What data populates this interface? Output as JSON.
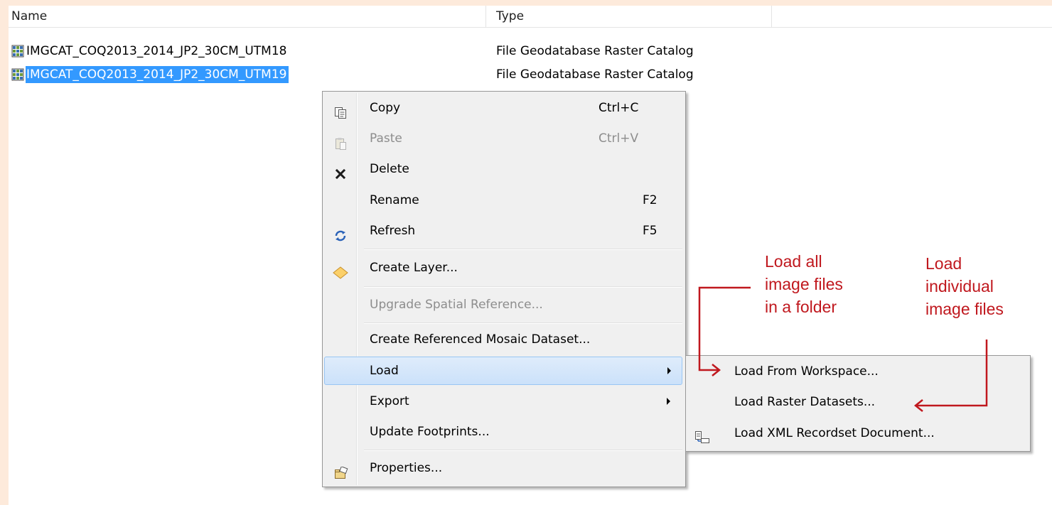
{
  "columns": {
    "name": "Name",
    "type": "Type"
  },
  "rows": [
    {
      "name": "IMGCAT_COQ2013_2014_JP2_30CM_UTM18",
      "type": "File Geodatabase Raster Catalog",
      "icon": "raster-catalog-icon",
      "selected": false
    },
    {
      "name": "IMGCAT_COQ2013_2014_JP2_30CM_UTM19",
      "type": "File Geodatabase Raster Catalog",
      "icon": "raster-catalog-icon",
      "selected": true
    }
  ],
  "context_menu": {
    "items": [
      {
        "label": "Copy",
        "shortcut": "Ctrl+C",
        "icon": "copy-icon",
        "enabled": true
      },
      {
        "label": "Paste",
        "shortcut": "Ctrl+V",
        "icon": "paste-icon",
        "enabled": false
      },
      {
        "label": "Delete",
        "shortcut": "",
        "icon": "delete-x-icon",
        "enabled": true
      },
      {
        "label": "Rename",
        "shortcut": "F2",
        "icon": "",
        "enabled": true
      },
      {
        "label": "Refresh",
        "shortcut": "F5",
        "icon": "refresh-icon",
        "enabled": true
      },
      {
        "label": "Create Layer...",
        "shortcut": "",
        "icon": "layer-diamond-icon",
        "enabled": true
      },
      {
        "label": "Upgrade Spatial Reference...",
        "shortcut": "",
        "icon": "",
        "enabled": false
      },
      {
        "label": "Create Referenced Mosaic Dataset...",
        "shortcut": "",
        "icon": "",
        "enabled": true
      },
      {
        "label": "Load",
        "shortcut": "",
        "icon": "",
        "enabled": true,
        "submenu": true,
        "highlighted": true
      },
      {
        "label": "Export",
        "shortcut": "",
        "icon": "",
        "enabled": true,
        "submenu": true
      },
      {
        "label": "Update Footprints...",
        "shortcut": "",
        "icon": "",
        "enabled": true
      },
      {
        "label": "Properties...",
        "shortcut": "",
        "icon": "properties-icon",
        "enabled": true
      }
    ]
  },
  "load_submenu": {
    "items": [
      {
        "label": "Load From Workspace...",
        "icon": ""
      },
      {
        "label": "Load Raster Datasets...",
        "icon": ""
      },
      {
        "label": "Load XML Recordset Document...",
        "icon": "xml-recordset-icon"
      }
    ]
  },
  "annotations": {
    "workspace": [
      "Load all",
      "image files",
      "in a folder"
    ],
    "raster": [
      "Load",
      "individual",
      "image files"
    ],
    "color": "#c0181e"
  },
  "colors": {
    "selection": "#3399ff",
    "menu_bg": "#f0f0f0",
    "highlight_bg": "#d5e7fb",
    "outer_bg": "#fdeadb"
  }
}
